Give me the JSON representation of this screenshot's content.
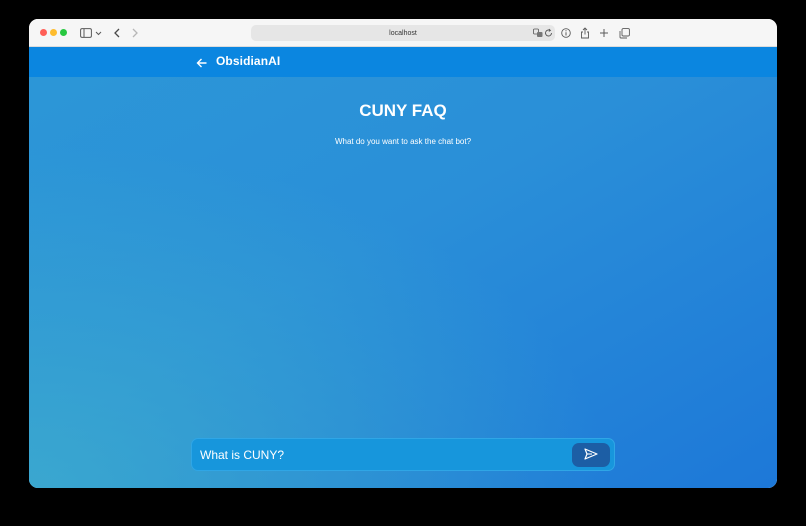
{
  "browser": {
    "url": "localhost",
    "icons": {
      "sidebar": "sidebar-icon",
      "back": "chevron-left-icon",
      "forward": "chevron-right-icon",
      "translate": "translate-icon",
      "reload": "reload-icon",
      "info": "info-icon",
      "share": "share-icon",
      "new_tab": "plus-icon",
      "tabs": "tabs-overview-icon"
    }
  },
  "app": {
    "brand": "ObsidianAI",
    "header_color": "#0b86e0"
  },
  "page": {
    "title": "CUNY FAQ",
    "subtitle": "What do you want to ask the chat bot?"
  },
  "chat": {
    "input_value": "What is CUNY?",
    "send_icon": "send-icon",
    "send_color": "#1c5ea5"
  }
}
